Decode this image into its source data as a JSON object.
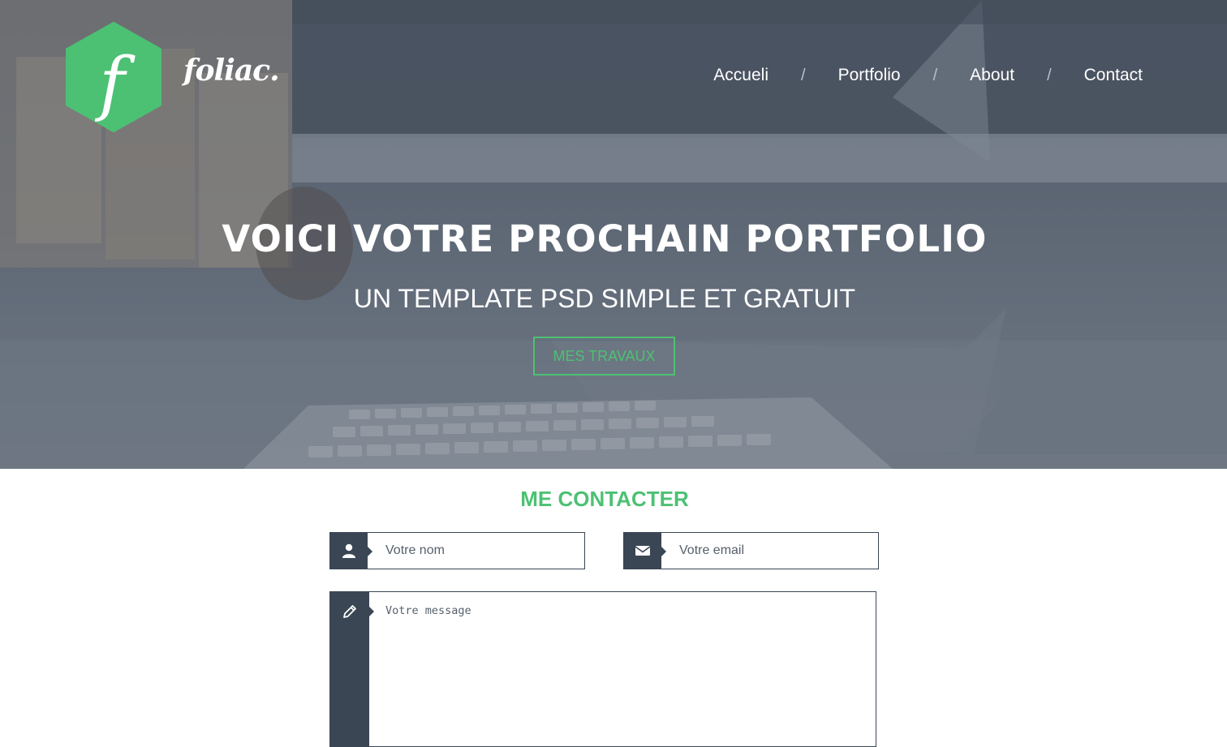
{
  "brand": {
    "logo_letter": "f",
    "name": "foliac.",
    "accent_color": "#4cc173"
  },
  "nav": {
    "items": [
      {
        "label": "Accueli"
      },
      {
        "label": "Portfolio"
      },
      {
        "label": "About"
      },
      {
        "label": "Contact"
      }
    ],
    "separator": "/"
  },
  "hero": {
    "title": "VOICI VOTRE PROCHAIN PORTFOLIO",
    "subtitle": "UN TEMPLATE PSD SIMPLE ET GRATUIT",
    "cta_label": "MES TRAVAUX"
  },
  "contact": {
    "title": "ME CONTACTER",
    "name_placeholder": "Votre nom",
    "email_placeholder": "Votre email",
    "message_placeholder": "Votre message",
    "icons": {
      "name": "user-icon",
      "email": "envelope-icon",
      "message": "pencil-icon"
    },
    "icon_bg_color": "#3a4654"
  }
}
